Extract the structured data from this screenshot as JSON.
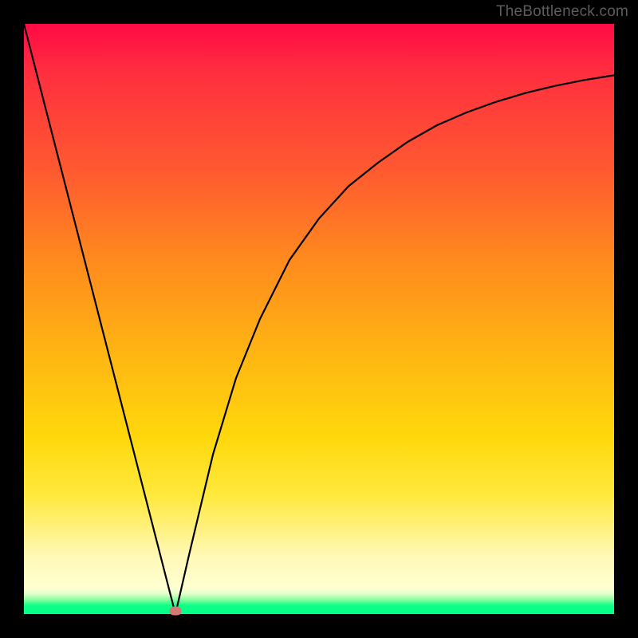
{
  "attribution": "TheBottleneck.com",
  "chart_data": {
    "type": "line",
    "title": "",
    "xlabel": "",
    "ylabel": "",
    "xlim": [
      0,
      100
    ],
    "ylim": [
      0,
      100
    ],
    "grid": false,
    "legend": false,
    "background_gradient": {
      "direction": "vertical",
      "stops": [
        {
          "pos": 0,
          "color": "#ff0a45"
        },
        {
          "pos": 0.25,
          "color": "#ff5a30"
        },
        {
          "pos": 0.55,
          "color": "#ffb313"
        },
        {
          "pos": 0.8,
          "color": "#ffe93e"
        },
        {
          "pos": 0.96,
          "color": "#ffffd0"
        },
        {
          "pos": 1.0,
          "color": "#00ff86"
        }
      ]
    },
    "series": [
      {
        "name": "curve",
        "x": [
          0,
          25.6,
          28,
          32,
          36,
          40,
          45,
          50,
          55,
          60,
          65,
          70,
          75,
          80,
          85,
          90,
          95,
          100
        ],
        "y": [
          100,
          0,
          10,
          27,
          40,
          50,
          60,
          67,
          72.5,
          76.5,
          80,
          82.8,
          85,
          86.8,
          88.3,
          89.5,
          90.5,
          91.3
        ]
      }
    ],
    "marker": {
      "x": 25.6,
      "y": 0,
      "color": "#d47a72"
    }
  }
}
